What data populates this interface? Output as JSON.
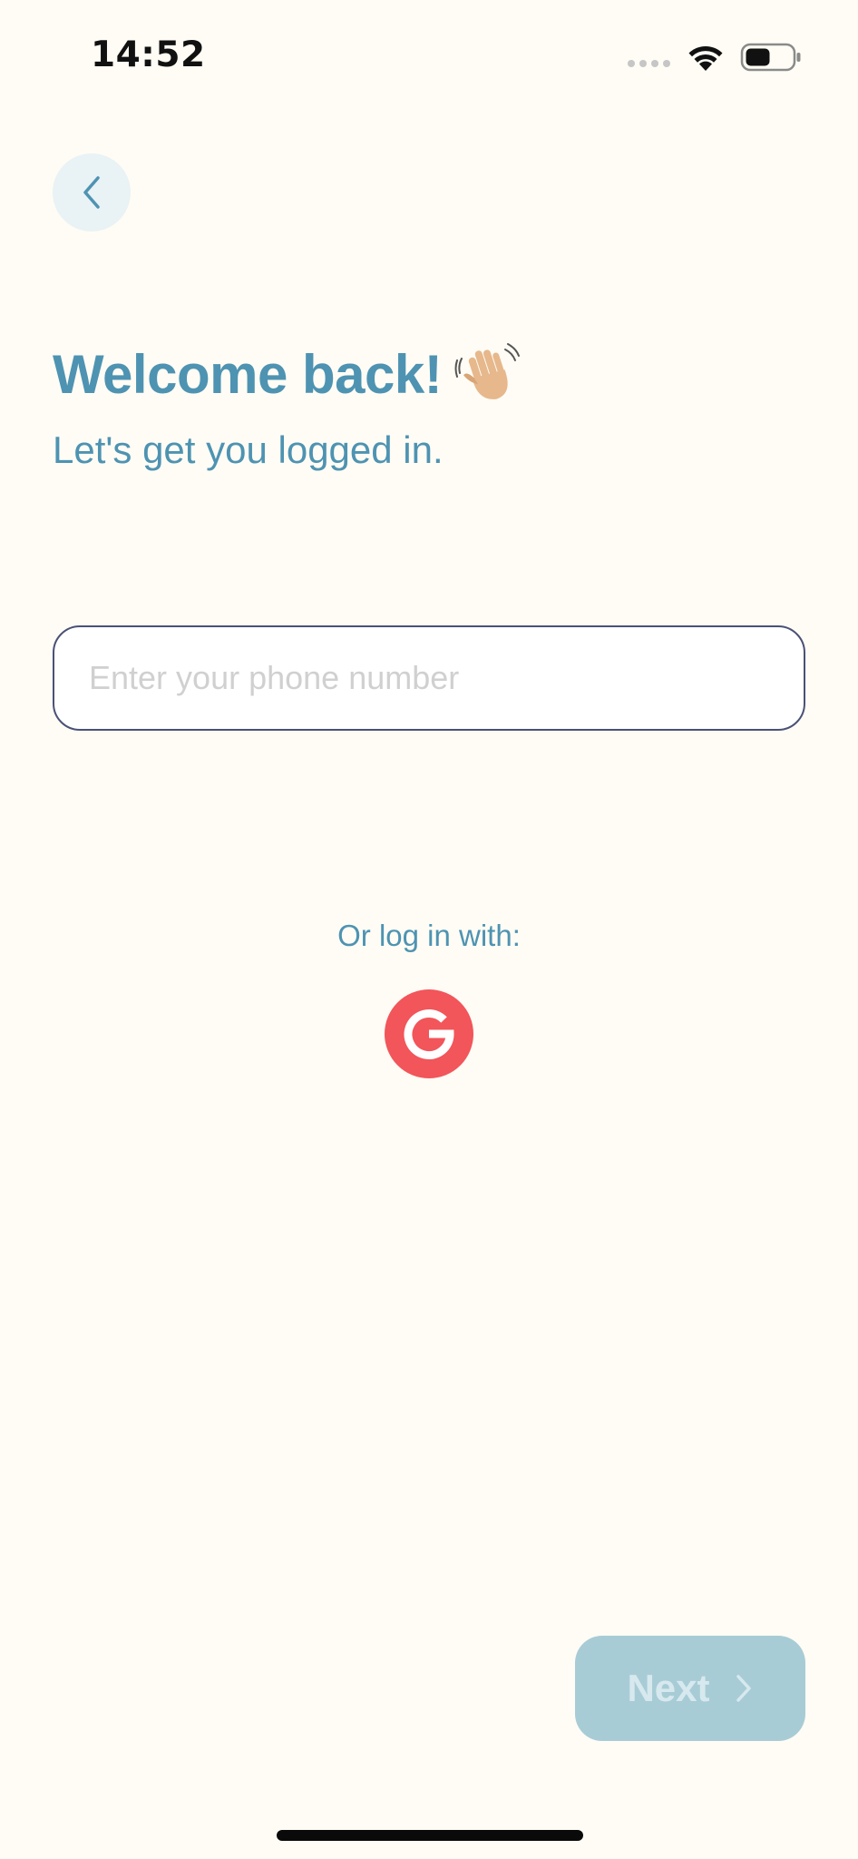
{
  "status_bar": {
    "time": "14:52",
    "icons": [
      "cellular-signal-icon",
      "wifi-icon",
      "battery-icon"
    ],
    "battery_level": 0.5
  },
  "back_button": {
    "icon": "chevron-left-icon"
  },
  "header": {
    "title": "Welcome back!",
    "title_icon": "waving-hand-icon",
    "subtitle": "Let's get you logged in."
  },
  "phone_input": {
    "placeholder": "Enter your phone number",
    "value": ""
  },
  "social_login": {
    "label": "Or log in with:",
    "google_icon": "google-icon"
  },
  "next_button": {
    "label": "Next",
    "icon": "chevron-right-icon",
    "enabled": false
  },
  "colors": {
    "background": "#fefcf4",
    "accent": "#4e93b2",
    "input_border": "#4a5177",
    "google_red": "#f2555a",
    "next_disabled": "#a8ccd6"
  }
}
